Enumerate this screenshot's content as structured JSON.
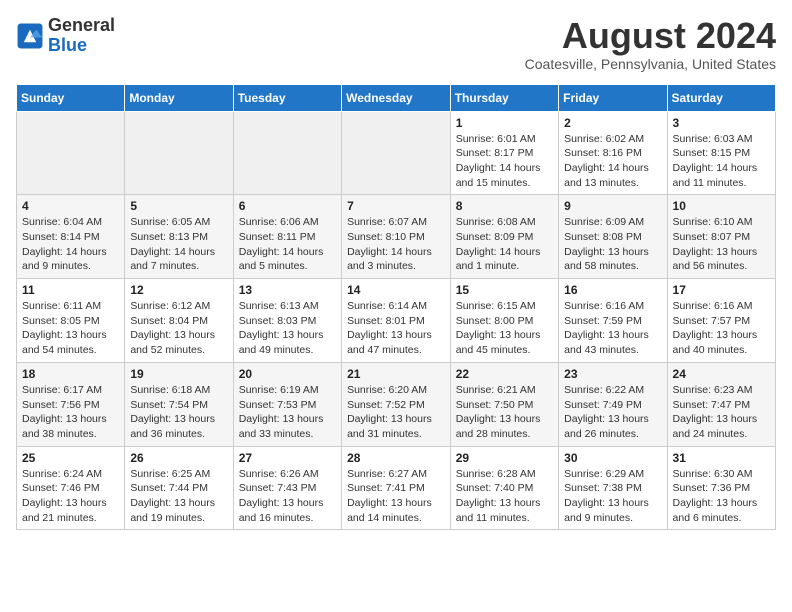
{
  "header": {
    "logo_line1": "General",
    "logo_line2": "Blue",
    "main_title": "August 2024",
    "subtitle": "Coatesville, Pennsylvania, United States"
  },
  "calendar": {
    "days_of_week": [
      "Sunday",
      "Monday",
      "Tuesday",
      "Wednesday",
      "Thursday",
      "Friday",
      "Saturday"
    ],
    "weeks": [
      [
        {
          "day": "",
          "info": ""
        },
        {
          "day": "",
          "info": ""
        },
        {
          "day": "",
          "info": ""
        },
        {
          "day": "",
          "info": ""
        },
        {
          "day": "1",
          "info": "Sunrise: 6:01 AM\nSunset: 8:17 PM\nDaylight: 14 hours\nand 15 minutes."
        },
        {
          "day": "2",
          "info": "Sunrise: 6:02 AM\nSunset: 8:16 PM\nDaylight: 14 hours\nand 13 minutes."
        },
        {
          "day": "3",
          "info": "Sunrise: 6:03 AM\nSunset: 8:15 PM\nDaylight: 14 hours\nand 11 minutes."
        }
      ],
      [
        {
          "day": "4",
          "info": "Sunrise: 6:04 AM\nSunset: 8:14 PM\nDaylight: 14 hours\nand 9 minutes."
        },
        {
          "day": "5",
          "info": "Sunrise: 6:05 AM\nSunset: 8:13 PM\nDaylight: 14 hours\nand 7 minutes."
        },
        {
          "day": "6",
          "info": "Sunrise: 6:06 AM\nSunset: 8:11 PM\nDaylight: 14 hours\nand 5 minutes."
        },
        {
          "day": "7",
          "info": "Sunrise: 6:07 AM\nSunset: 8:10 PM\nDaylight: 14 hours\nand 3 minutes."
        },
        {
          "day": "8",
          "info": "Sunrise: 6:08 AM\nSunset: 8:09 PM\nDaylight: 14 hours\nand 1 minute."
        },
        {
          "day": "9",
          "info": "Sunrise: 6:09 AM\nSunset: 8:08 PM\nDaylight: 13 hours\nand 58 minutes."
        },
        {
          "day": "10",
          "info": "Sunrise: 6:10 AM\nSunset: 8:07 PM\nDaylight: 13 hours\nand 56 minutes."
        }
      ],
      [
        {
          "day": "11",
          "info": "Sunrise: 6:11 AM\nSunset: 8:05 PM\nDaylight: 13 hours\nand 54 minutes."
        },
        {
          "day": "12",
          "info": "Sunrise: 6:12 AM\nSunset: 8:04 PM\nDaylight: 13 hours\nand 52 minutes."
        },
        {
          "day": "13",
          "info": "Sunrise: 6:13 AM\nSunset: 8:03 PM\nDaylight: 13 hours\nand 49 minutes."
        },
        {
          "day": "14",
          "info": "Sunrise: 6:14 AM\nSunset: 8:01 PM\nDaylight: 13 hours\nand 47 minutes."
        },
        {
          "day": "15",
          "info": "Sunrise: 6:15 AM\nSunset: 8:00 PM\nDaylight: 13 hours\nand 45 minutes."
        },
        {
          "day": "16",
          "info": "Sunrise: 6:16 AM\nSunset: 7:59 PM\nDaylight: 13 hours\nand 43 minutes."
        },
        {
          "day": "17",
          "info": "Sunrise: 6:16 AM\nSunset: 7:57 PM\nDaylight: 13 hours\nand 40 minutes."
        }
      ],
      [
        {
          "day": "18",
          "info": "Sunrise: 6:17 AM\nSunset: 7:56 PM\nDaylight: 13 hours\nand 38 minutes."
        },
        {
          "day": "19",
          "info": "Sunrise: 6:18 AM\nSunset: 7:54 PM\nDaylight: 13 hours\nand 36 minutes."
        },
        {
          "day": "20",
          "info": "Sunrise: 6:19 AM\nSunset: 7:53 PM\nDaylight: 13 hours\nand 33 minutes."
        },
        {
          "day": "21",
          "info": "Sunrise: 6:20 AM\nSunset: 7:52 PM\nDaylight: 13 hours\nand 31 minutes."
        },
        {
          "day": "22",
          "info": "Sunrise: 6:21 AM\nSunset: 7:50 PM\nDaylight: 13 hours\nand 28 minutes."
        },
        {
          "day": "23",
          "info": "Sunrise: 6:22 AM\nSunset: 7:49 PM\nDaylight: 13 hours\nand 26 minutes."
        },
        {
          "day": "24",
          "info": "Sunrise: 6:23 AM\nSunset: 7:47 PM\nDaylight: 13 hours\nand 24 minutes."
        }
      ],
      [
        {
          "day": "25",
          "info": "Sunrise: 6:24 AM\nSunset: 7:46 PM\nDaylight: 13 hours\nand 21 minutes."
        },
        {
          "day": "26",
          "info": "Sunrise: 6:25 AM\nSunset: 7:44 PM\nDaylight: 13 hours\nand 19 minutes."
        },
        {
          "day": "27",
          "info": "Sunrise: 6:26 AM\nSunset: 7:43 PM\nDaylight: 13 hours\nand 16 minutes."
        },
        {
          "day": "28",
          "info": "Sunrise: 6:27 AM\nSunset: 7:41 PM\nDaylight: 13 hours\nand 14 minutes."
        },
        {
          "day": "29",
          "info": "Sunrise: 6:28 AM\nSunset: 7:40 PM\nDaylight: 13 hours\nand 11 minutes."
        },
        {
          "day": "30",
          "info": "Sunrise: 6:29 AM\nSunset: 7:38 PM\nDaylight: 13 hours\nand 9 minutes."
        },
        {
          "day": "31",
          "info": "Sunrise: 6:30 AM\nSunset: 7:36 PM\nDaylight: 13 hours\nand 6 minutes."
        }
      ]
    ]
  }
}
